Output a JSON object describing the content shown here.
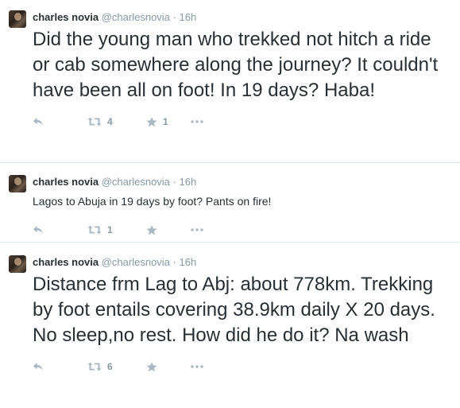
{
  "tweets": [
    {
      "name": "charles novia",
      "handle": "@charlesnovia",
      "separator": "·",
      "time": "16h",
      "text": "Did the young man who trekked not hitch a ride or cab somewhere along the journey? It couldn't have been all on foot! In 19 days? Haba!",
      "retweets": "4",
      "favorites": "1"
    },
    {
      "name": "charles novia",
      "handle": "@charlesnovia",
      "separator": "·",
      "time": "16h",
      "text": "Lagos to Abuja in 19 days by foot? Pants on fire!",
      "retweets": "1",
      "favorites": ""
    },
    {
      "name": "charles novia",
      "handle": "@charlesnovia",
      "separator": "·",
      "time": "16h",
      "text": "Distance frm Lag to Abj: about 778km. Trekking by foot entails covering 38.9km daily X 20 days. No sleep,no rest. How did he do it? Na wash",
      "retweets": "6",
      "favorites": ""
    }
  ],
  "icons": {
    "reply": "reply-icon",
    "retweet": "retweet-icon",
    "favorite": "star-icon",
    "more": "more-icon"
  },
  "colors": {
    "text": "#292f33",
    "meta": "#8899a6",
    "action": "#aab8c2",
    "divider": "#e1e8ed"
  }
}
